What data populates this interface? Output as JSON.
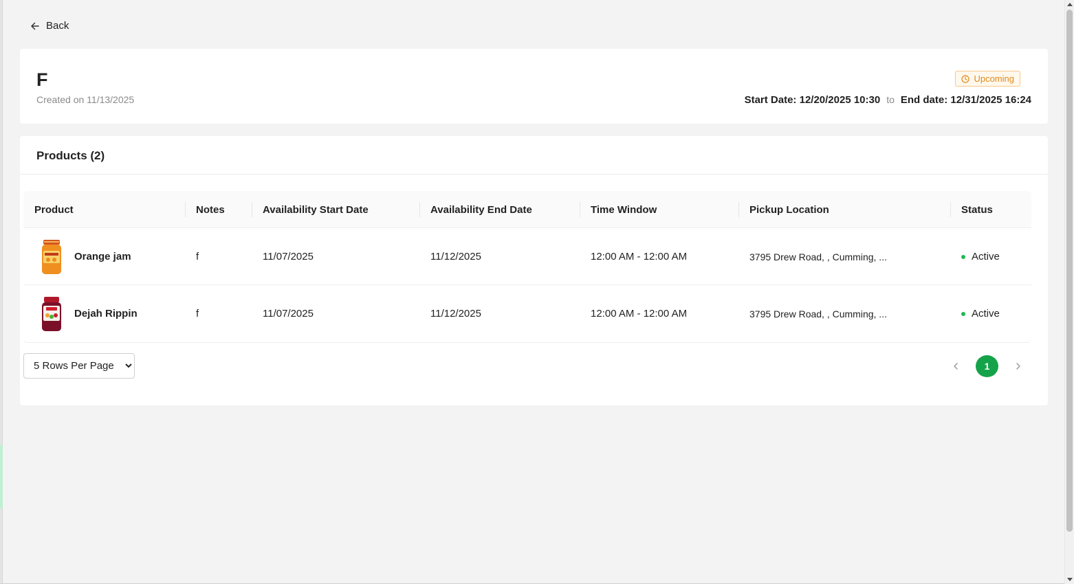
{
  "nav": {
    "back_label": "Back"
  },
  "header": {
    "title": "F",
    "created": "Created on 11/13/2025",
    "status_badge": "Upcoming",
    "start_date": "Start Date: 12/20/2025 10:30",
    "to_label": "to",
    "end_date": "End date: 12/31/2025 16:24",
    "badge_color": "#e08a1e"
  },
  "products": {
    "title": "Products (2)",
    "columns": [
      "Product",
      "Notes",
      "Availability Start Date",
      "Availability End Date",
      "Time Window",
      "Pickup Location",
      "Status"
    ],
    "rows": [
      {
        "name": "Orange jam",
        "image_icon": "orange-jam-jar",
        "notes": "f",
        "start": "11/07/2025",
        "end": "11/12/2025",
        "time_window": "12:00 AM - 12:00 AM",
        "location": "3795 Drew Road, , Cumming, ...",
        "status": "Active"
      },
      {
        "name": "Dejah Rippin",
        "image_icon": "berry-jam-jar",
        "notes": "f",
        "start": "11/07/2025",
        "end": "11/12/2025",
        "time_window": "12:00 AM - 12:00 AM",
        "location": "3795 Drew Road, , Cumming, ...",
        "status": "Active"
      }
    ],
    "status_color": "#1db954"
  },
  "pagination": {
    "rows_per_page": "5 Rows Per Page",
    "current_page": "1",
    "accent": "#15a34a"
  }
}
